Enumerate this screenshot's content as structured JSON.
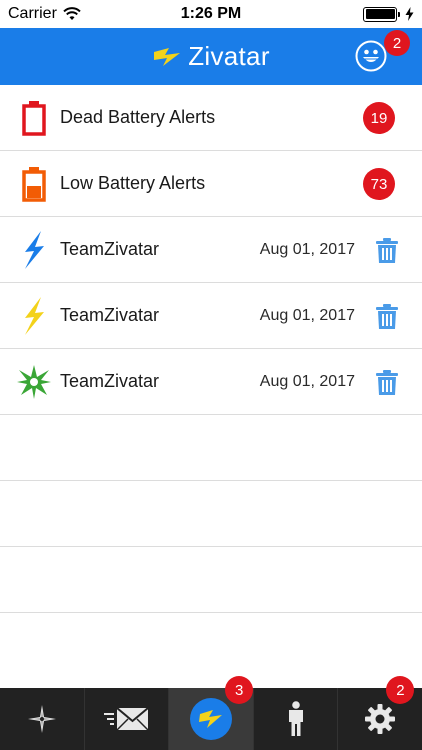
{
  "status_bar": {
    "carrier": "Carrier",
    "time": "1:26 PM"
  },
  "nav": {
    "title": "Zivatar",
    "avatar_badge": "2"
  },
  "list": {
    "alerts": [
      {
        "title": "Dead Battery Alerts",
        "count": "19",
        "icon": "dead-battery-icon",
        "color": "#e0161e"
      },
      {
        "title": "Low Battery Alerts",
        "count": "73",
        "icon": "low-battery-icon",
        "color": "#f25c05"
      }
    ],
    "messages": [
      {
        "title": "TeamZivatar",
        "date": "Aug 01, 2017",
        "icon": "blue-bolt-icon",
        "color": "#1a7de8"
      },
      {
        "title": "TeamZivatar",
        "date": "Aug 01, 2017",
        "icon": "yellow-bolt-icon",
        "color": "#f3d21a"
      },
      {
        "title": "TeamZivatar",
        "date": "Aug 01, 2017",
        "icon": "green-star-icon",
        "color": "#3aa636"
      }
    ]
  },
  "tabs": [
    {
      "icon": "compass-icon",
      "badge": ""
    },
    {
      "icon": "mail-icon",
      "badge": ""
    },
    {
      "icon": "bolt-icon",
      "badge": "3"
    },
    {
      "icon": "person-icon",
      "badge": ""
    },
    {
      "icon": "gear-icon",
      "badge": "2"
    }
  ],
  "colors": {
    "accent": "#1a7de8",
    "badge": "#e0161e",
    "tab_bar": "#222222",
    "trash": "#4a9be8"
  }
}
